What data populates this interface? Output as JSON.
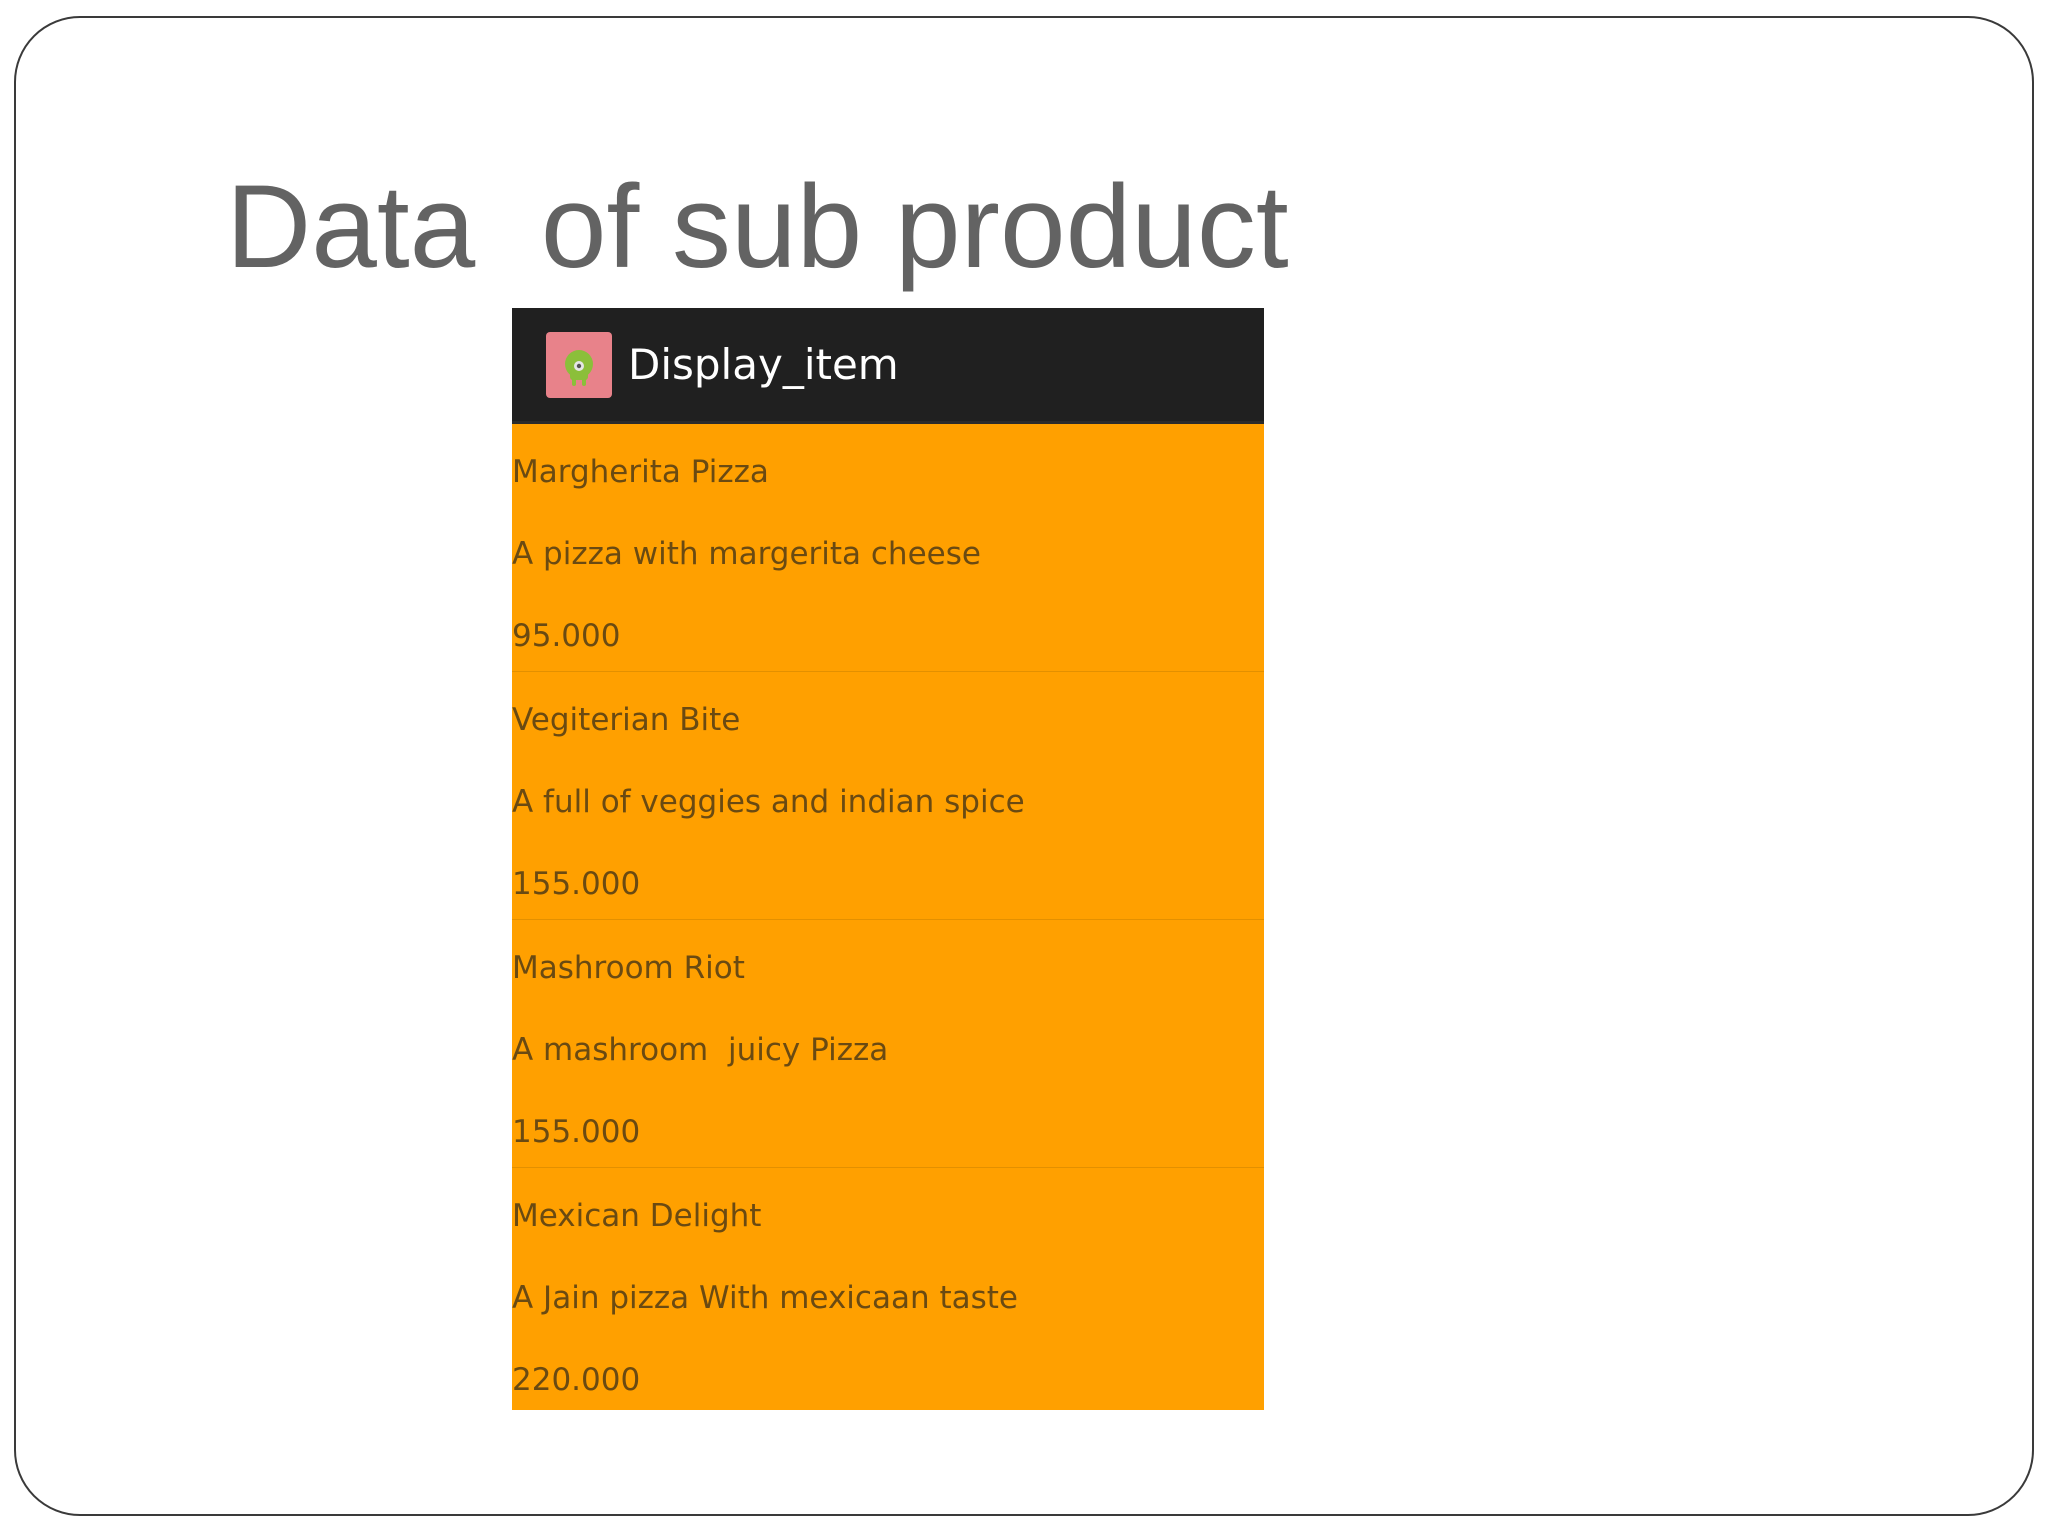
{
  "slide": {
    "title": "Data  of sub product"
  },
  "app": {
    "icon": "android-app-icon",
    "title": "Display_item"
  },
  "items": [
    {
      "name": "Margherita Pizza",
      "description": "A pizza with margerita cheese",
      "price": "95.000"
    },
    {
      "name": "Vegiterian Bite",
      "description": "A full of veggies and indian spice",
      "price": "155.000"
    },
    {
      "name": "Mashroom Riot",
      "description": "A mashroom  juicy Pizza",
      "price": "155.000"
    },
    {
      "name": "Mexican Delight",
      "description": "A Jain pizza With mexicaan taste",
      "price": "220.000"
    }
  ],
  "colors": {
    "list_background": "#ffa000",
    "action_bar": "#202020",
    "title_text": "#636363"
  }
}
